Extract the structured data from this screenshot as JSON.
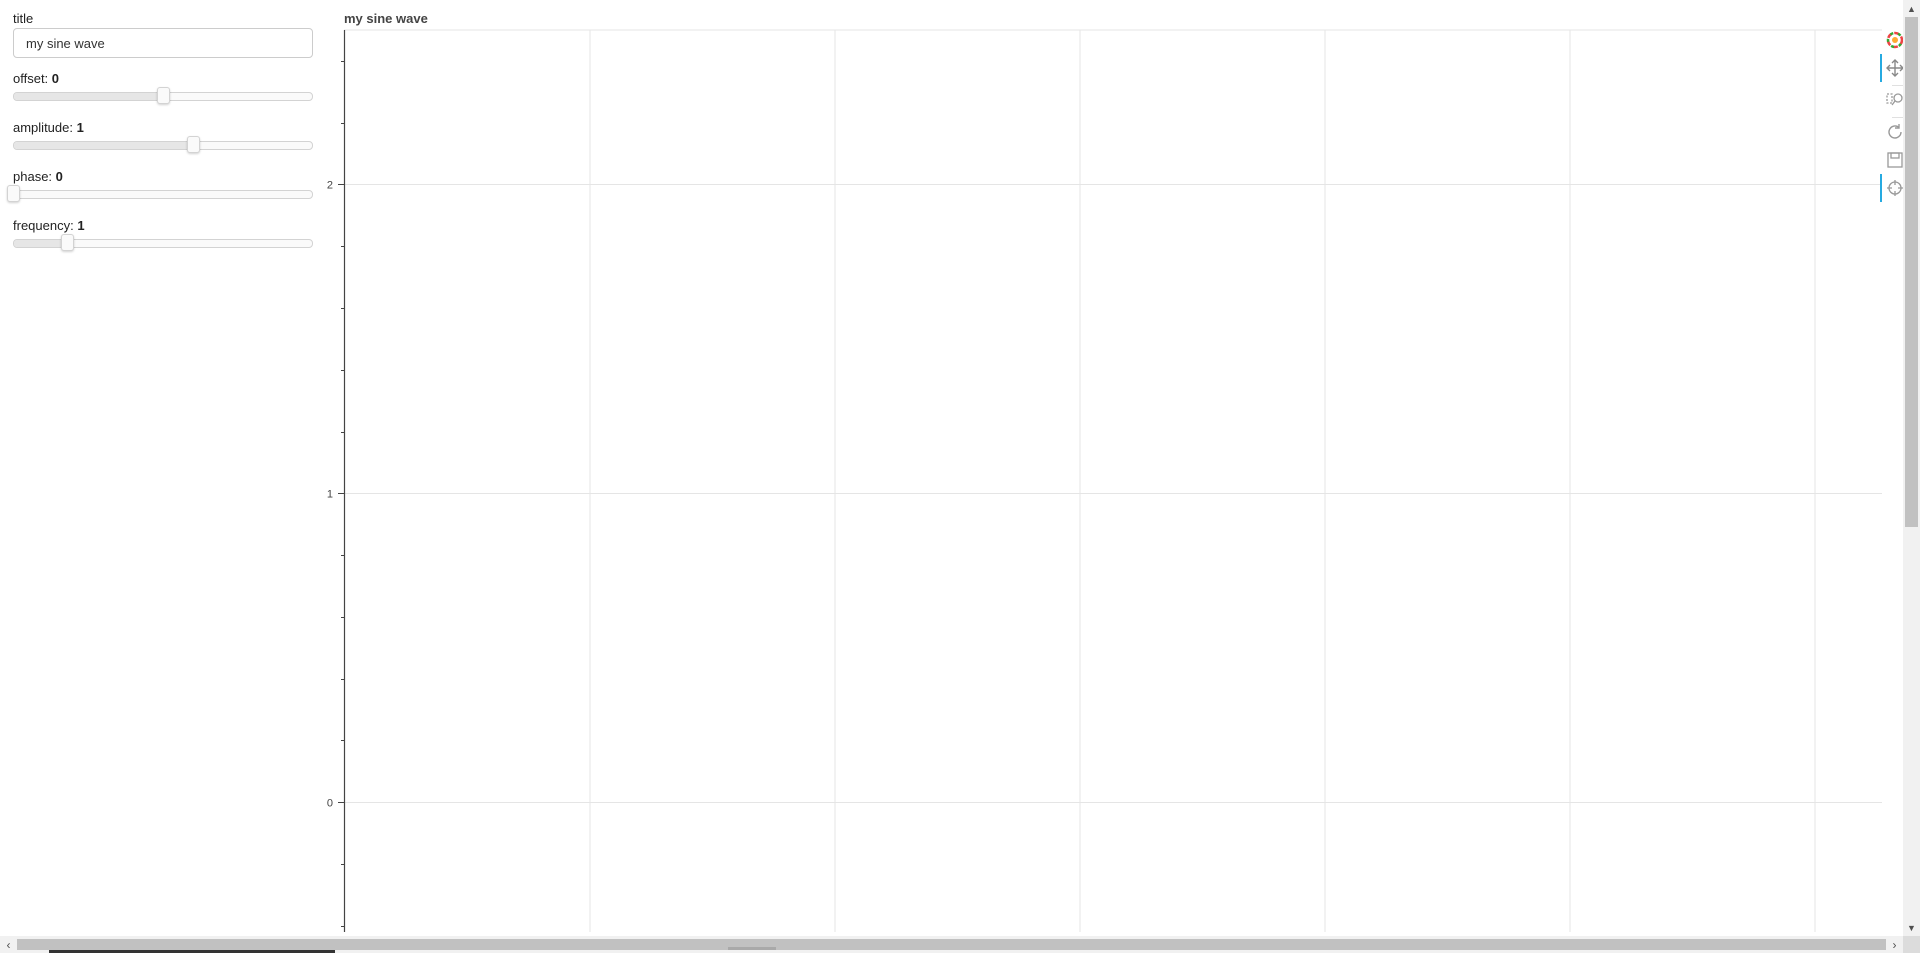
{
  "widgets": {
    "title": {
      "label": "title",
      "value": "my sine wave"
    },
    "offset": {
      "label": "offset: ",
      "value": "0",
      "fraction": 0.5
    },
    "amplitude": {
      "label": "amplitude: ",
      "value": "1",
      "fraction": 0.6
    },
    "phase": {
      "label": "phase: ",
      "value": "0",
      "fraction": 0.0
    },
    "frequency": {
      "label": "frequency: ",
      "value": "1",
      "fraction": 0.18
    }
  },
  "plot": {
    "title": "my sine wave"
  },
  "chart_data": {
    "type": "line",
    "title": "my sine wave",
    "xlabel": "",
    "ylabel": "",
    "ylim": [
      -0.42,
      2.5
    ],
    "y_major_ticks": [
      0,
      1,
      2
    ],
    "y_minor_step": 0.2,
    "grid": true,
    "series": []
  },
  "toolbar": {
    "icons": [
      "bokeh-logo-icon",
      "pan-icon",
      "box-zoom-icon",
      "reset-icon",
      "save-icon",
      "hover-icon"
    ],
    "active": [
      "pan-icon",
      "hover-icon"
    ]
  },
  "colors": {
    "grid": "#e5e5e5",
    "axis": "#444444",
    "active_tool": "#26aae1",
    "slider_fill": "#e6e6e6"
  }
}
